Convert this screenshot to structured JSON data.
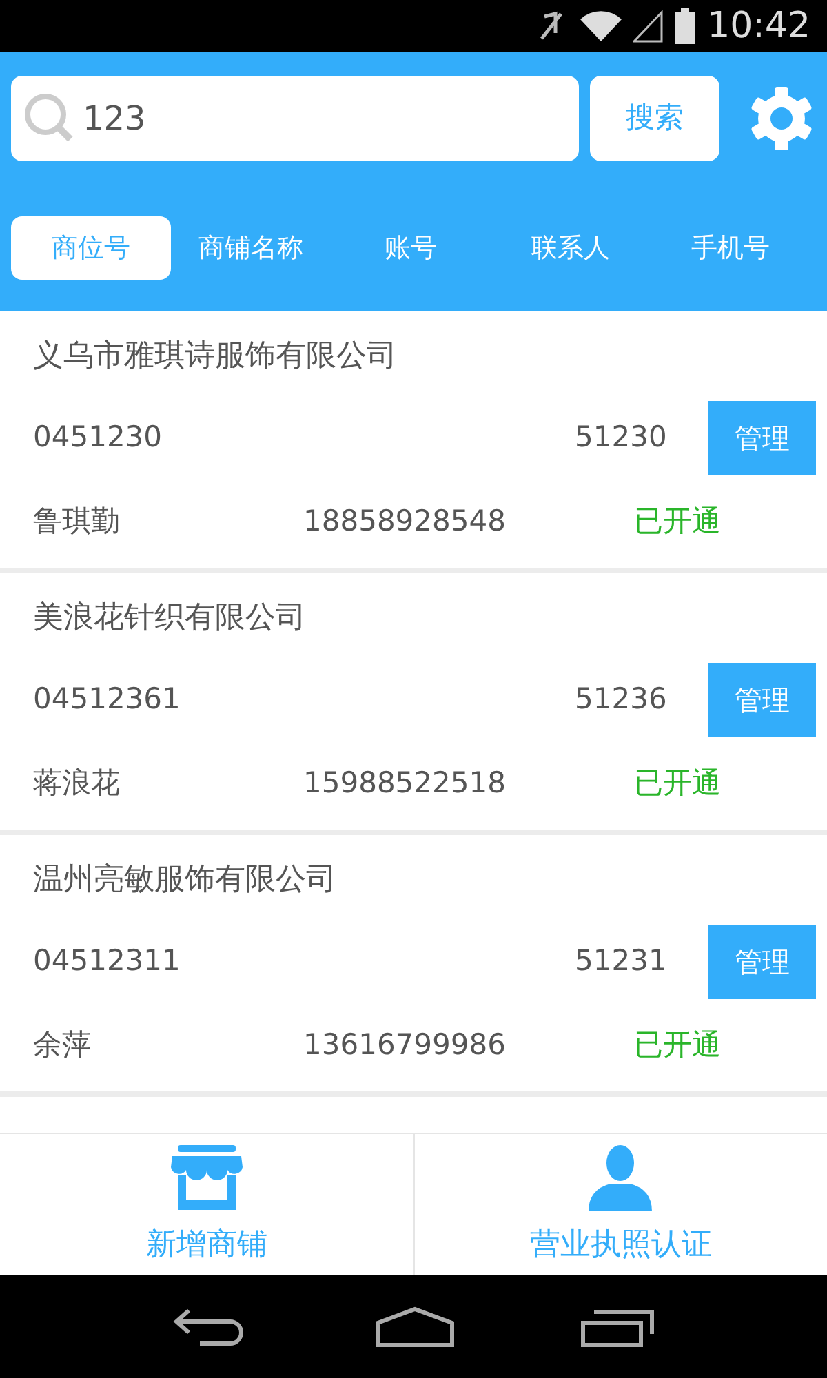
{
  "status_bar": {
    "time": "10:42"
  },
  "search": {
    "value": "123",
    "button": "搜索"
  },
  "tabs": [
    {
      "label": "商位号",
      "selected": true
    },
    {
      "label": "商铺名称",
      "selected": false
    },
    {
      "label": "账号",
      "selected": false
    },
    {
      "label": "联系人",
      "selected": false
    },
    {
      "label": "手机号",
      "selected": false
    }
  ],
  "shops": [
    {
      "name": "义乌市雅琪诗服饰有限公司",
      "stall": "0451230",
      "account": "51230",
      "action": "管理",
      "contact": "鲁琪勤",
      "phone": "18858928548",
      "status": "已开通"
    },
    {
      "name": "美浪花针织有限公司",
      "stall": "04512361",
      "account": "51236",
      "action": "管理",
      "contact": "蒋浪花",
      "phone": "15988522518",
      "status": "已开通"
    },
    {
      "name": "温州亮敏服饰有限公司",
      "stall": "04512311",
      "account": "51231",
      "action": "管理",
      "contact": "余萍",
      "phone": "13616799986",
      "status": "已开通"
    }
  ],
  "bottom_actions": [
    {
      "label": "新增商铺",
      "kind": "store"
    },
    {
      "label": "营业执照认证",
      "kind": "person"
    }
  ]
}
